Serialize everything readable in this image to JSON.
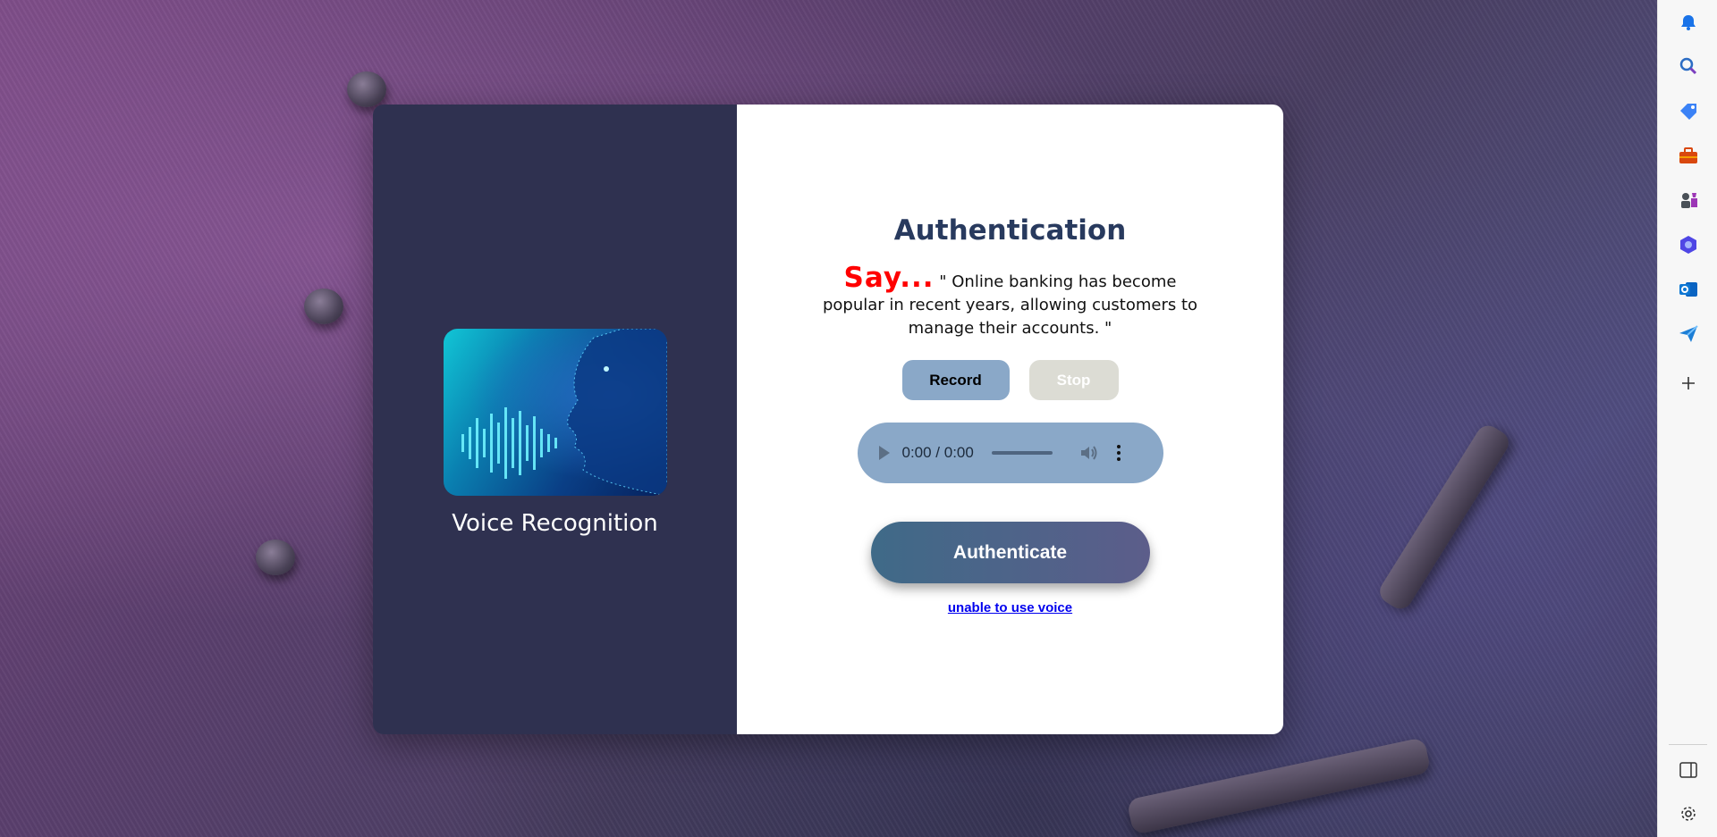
{
  "left_panel": {
    "title": "Voice Recognition",
    "image_icon": "voice-face-waveform-image"
  },
  "main": {
    "heading": "Authentication",
    "say_label": "Say...",
    "phrase": " \" Online banking has become popular in recent years, allowing customers to manage their accounts. \"",
    "record_label": "Record",
    "stop_label": "Stop",
    "audio": {
      "time": "0:00 / 0:00",
      "icons": [
        "play-icon",
        "volume-icon",
        "more-options-icon"
      ]
    },
    "authenticate_label": "Authenticate",
    "fallback_link": "unable to use voice"
  },
  "sidebar": {
    "icons": [
      "bell-icon",
      "search-icon",
      "tag-icon",
      "toolbox-icon",
      "chess-icon",
      "copilot-icon",
      "outlook-icon",
      "send-icon",
      "plus-icon",
      "split-view-icon",
      "settings-icon"
    ]
  },
  "colors": {
    "left_panel_bg": "#2f3150",
    "heading": "#283a5e",
    "say": "#ff0000",
    "record_bg": "#8aa8c8",
    "stop_bg": "#dcdcd4",
    "link": "#0000ee"
  }
}
